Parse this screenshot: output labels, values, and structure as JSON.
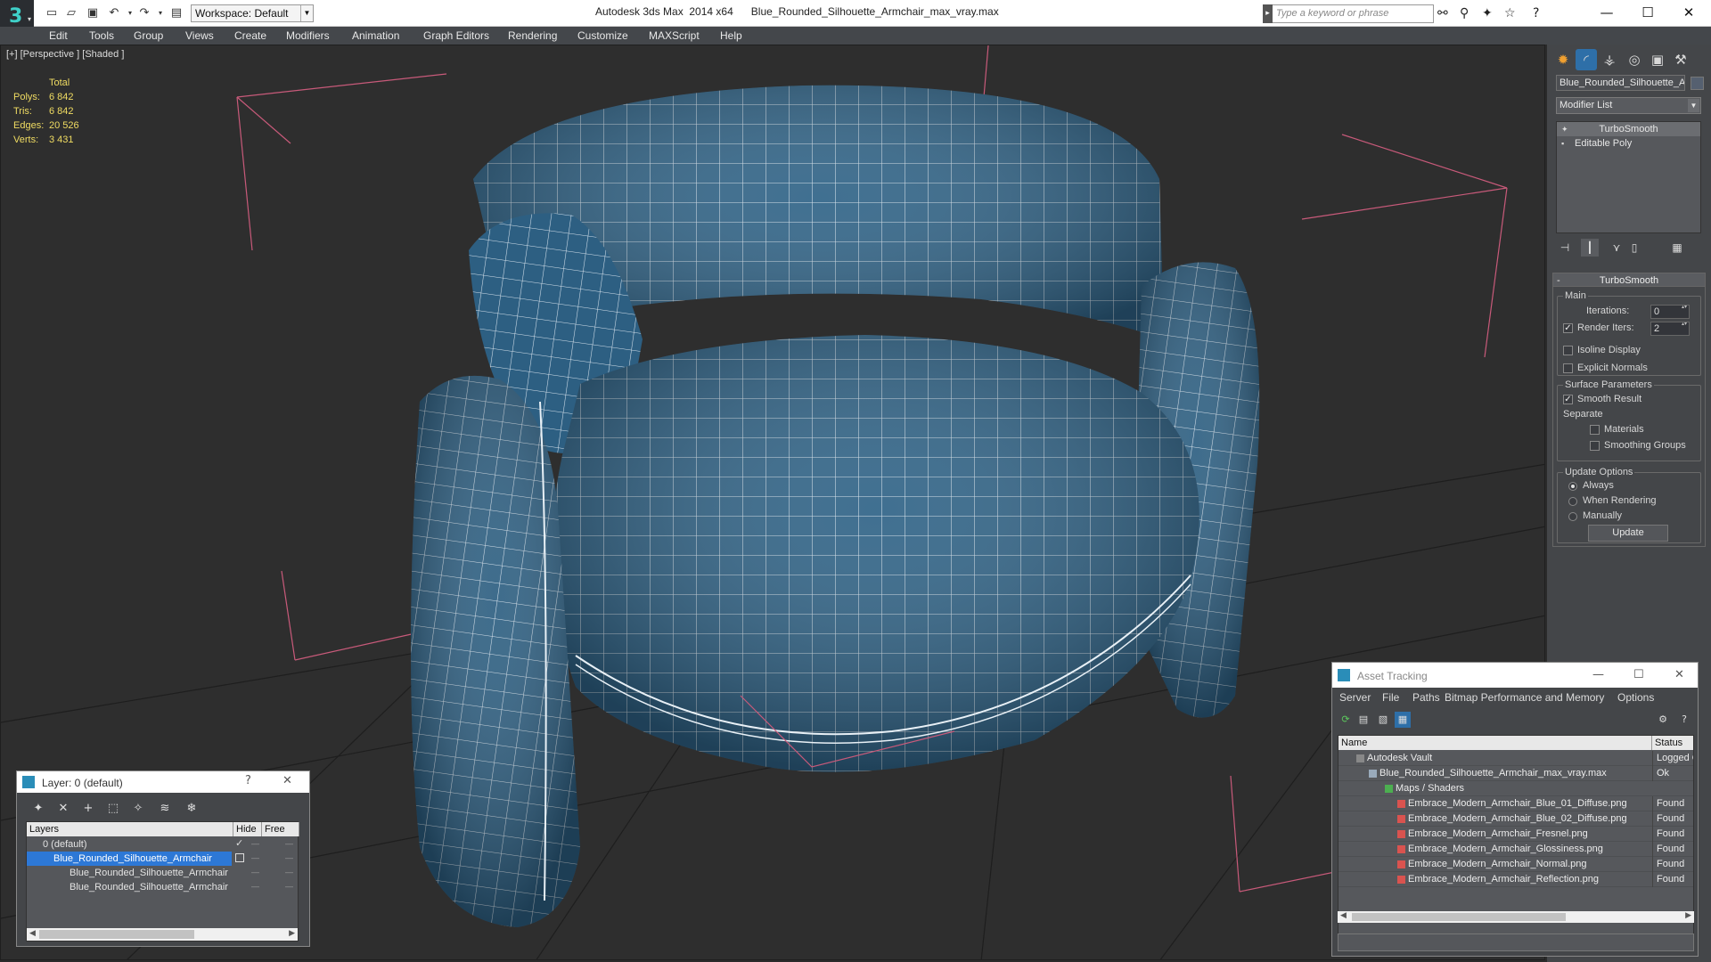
{
  "titlebar": {
    "app_title": "Autodesk 3ds Max  2014 x64",
    "file_name": "Blue_Rounded_Silhouette_Armchair_max_vray.max",
    "workspace": "Workspace: Default",
    "search_placeholder": "Type a keyword or phrase",
    "icons": [
      "new-icon",
      "open-icon",
      "save-icon",
      "undo-icon",
      "redo-icon",
      "project-icon",
      "binoculars-icon",
      "search-icon",
      "star-icon",
      "help-icon"
    ]
  },
  "menubar": {
    "items": [
      "Edit",
      "Tools",
      "Group",
      "Views",
      "Create",
      "Modifiers",
      "Animation",
      "Graph Editors",
      "Rendering",
      "Customize",
      "MAXScript",
      "Help"
    ]
  },
  "viewport": {
    "label": "[+] [Perspective ] [Shaded ]",
    "stats": {
      "header": "Total",
      "polys_label": "Polys:",
      "polys": "6 842",
      "tris_label": "Tris:",
      "tris": "6 842",
      "edges_label": "Edges:",
      "edges": "20 526",
      "verts_label": "Verts:",
      "verts": "3 431"
    },
    "mesh_color": "#2f6387",
    "wire_color": "#ffffff",
    "grid_color": "#1c1c1c"
  },
  "command_panel": {
    "object_name": "Blue_Rounded_Silhouette_Ar",
    "modifier_list": "Modifier List",
    "stack": [
      "TurboSmooth",
      "Editable Poly"
    ],
    "rollout_title": "TurboSmooth",
    "main_group": "Main",
    "iterations_label": "Iterations:",
    "iterations_value": "0",
    "render_iters_label": "Render Iters:",
    "render_iters_value": "2",
    "isoline_label": "Isoline Display",
    "explicit_normals_label": "Explicit Normals",
    "surface_group": "Surface Parameters",
    "smooth_result_label": "Smooth Result",
    "separate_label": "Separate",
    "materials_label": "Materials",
    "smoothing_groups_label": "Smoothing Groups",
    "update_group": "Update Options",
    "always_label": "Always",
    "when_rendering_label": "When Rendering",
    "manually_label": "Manually",
    "update_button": "Update"
  },
  "layer_dialog": {
    "title": "Layer: 0 (default)",
    "help_glyph": "?",
    "col_layers": "Layers",
    "col_hide": "Hide",
    "col_freeze": "Free",
    "rows": [
      {
        "name": "0 (default)"
      },
      {
        "name": "Blue_Rounded_Silhouette_Armchair"
      },
      {
        "name": "Blue_Rounded_Silhouette_Armchair"
      },
      {
        "name": "Blue_Rounded_Silhouette_Armchair"
      }
    ]
  },
  "asset_tracking": {
    "title": "Asset Tracking",
    "menu": [
      "Server",
      "File",
      "Paths",
      "Bitmap Performance and Memory",
      "Options"
    ],
    "col_name": "Name",
    "col_status": "Status",
    "rows": [
      {
        "name": "Autodesk Vault",
        "status": "Logged O"
      },
      {
        "name": "Blue_Rounded_Silhouette_Armchair_max_vray.max",
        "status": "Ok"
      },
      {
        "name": "Maps / Shaders",
        "status": ""
      },
      {
        "name": "Embrace_Modern_Armchair_Blue_01_Diffuse.png",
        "status": "Found"
      },
      {
        "name": "Embrace_Modern_Armchair_Blue_02_Diffuse.png",
        "status": "Found"
      },
      {
        "name": "Embrace_Modern_Armchair_Fresnel.png",
        "status": "Found"
      },
      {
        "name": "Embrace_Modern_Armchair_Glossiness.png",
        "status": "Found"
      },
      {
        "name": "Embrace_Modern_Armchair_Normal.png",
        "status": "Found"
      },
      {
        "name": "Embrace_Modern_Armchair_Reflection.png",
        "status": "Found"
      }
    ]
  }
}
